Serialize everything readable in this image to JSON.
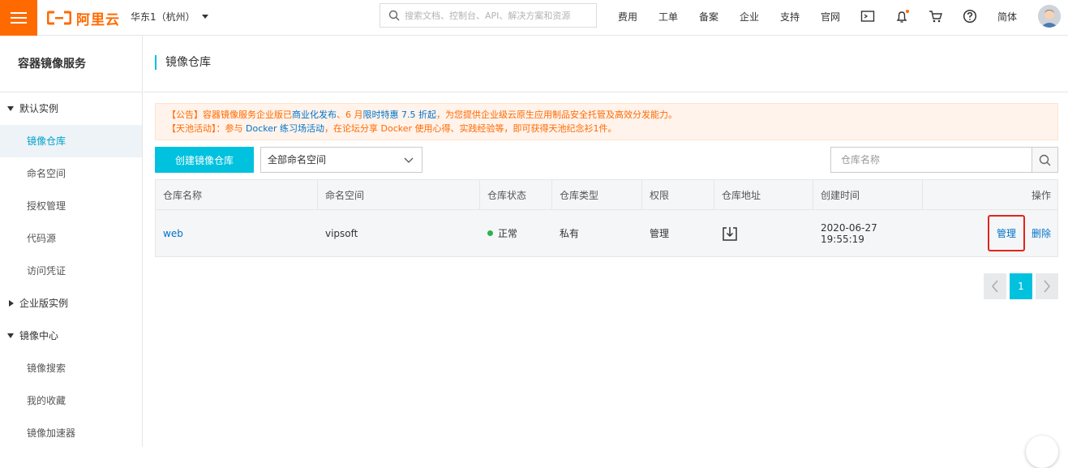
{
  "topbar": {
    "logo_text": "阿里云",
    "region": "华东1（杭州）",
    "search_placeholder": "搜索文档、控制台、API、解决方案和资源",
    "nav": [
      "费用",
      "工单",
      "备案",
      "企业",
      "支持",
      "官网"
    ],
    "lang": "简体",
    "brand_color": "#ff6a00"
  },
  "sidebar": {
    "title": "容器镜像服务",
    "groups": [
      {
        "label": "默认实例",
        "expanded": true,
        "items": [
          "镜像仓库",
          "命名空间",
          "授权管理",
          "代码源",
          "访问凭证"
        ]
      },
      {
        "label": "企业版实例",
        "expanded": false,
        "items": []
      },
      {
        "label": "镜像中心",
        "expanded": true,
        "items": [
          "镜像搜索",
          "我的收藏",
          "镜像加速器"
        ]
      }
    ],
    "active_item": "镜像仓库"
  },
  "main": {
    "title": "镜像仓库",
    "notice": {
      "line1_prefix": "【公告】容器镜像服务企业版已",
      "line1_link1": "商业化发布",
      "line1_mid": "、6 月",
      "line1_link2": "限时特惠 7.5 折起",
      "line1_suffix": "，为您提供企业级云原生应用制品安全托管及高效分发能力。",
      "line2_prefix": "【天池活动】：参与 ",
      "line2_link": "Docker 练习场活动",
      "line2_suffix": "，在论坛分享 Docker 使用心得、实践经验等，即可获得天池纪念衫1件。"
    },
    "create_button": "创建镜像仓库",
    "namespace_select": "全部命名空间",
    "repo_search_placeholder": "仓库名称",
    "table": {
      "headers": [
        "仓库名称",
        "命名空间",
        "仓库状态",
        "仓库类型",
        "权限",
        "仓库地址",
        "创建时间",
        "操作"
      ],
      "rows": [
        {
          "name": "web",
          "namespace": "vipsoft",
          "status": "正常",
          "type": "私有",
          "permission": "管理",
          "created": "2020-06-27 19:55:19",
          "op_manage": "管理",
          "op_delete": "删除"
        }
      ]
    },
    "pagination": {
      "current": "1"
    }
  }
}
